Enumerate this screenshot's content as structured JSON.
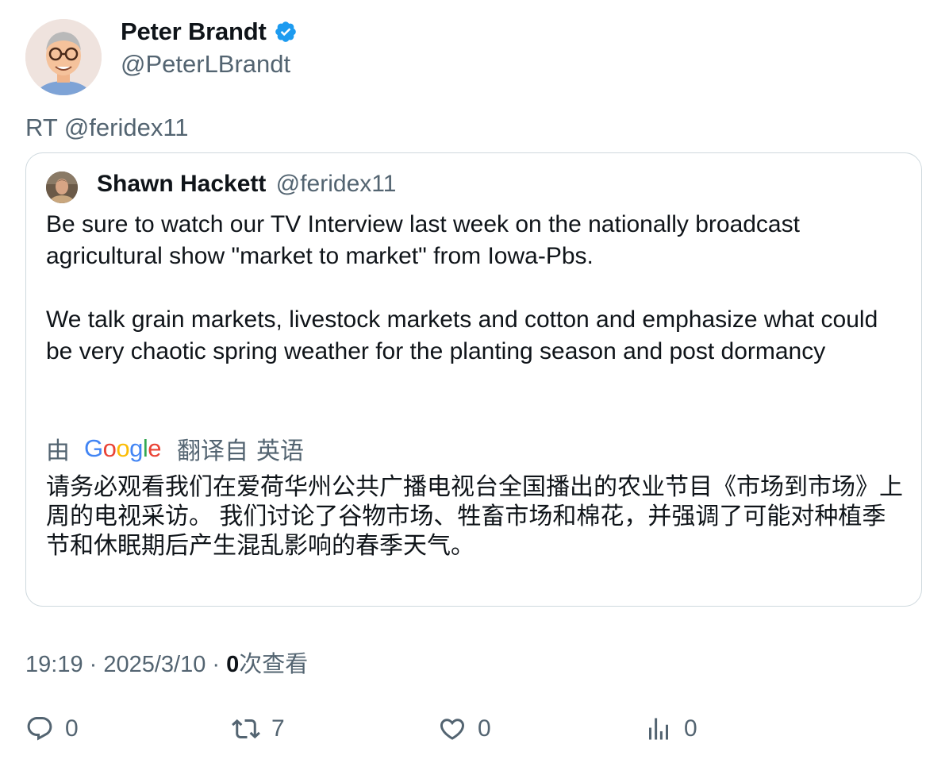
{
  "author": {
    "display_name": "Peter Brandt",
    "handle": "@PeterLBrandt",
    "verified_color": "#1d9bf0"
  },
  "retweet_line": "RT @feridex11",
  "quoted": {
    "display_name": "Shawn Hackett",
    "handle": "@feridex11",
    "paragraphs": [
      "Be sure to watch our TV Interview last week on the nationally broadcast agricultural show \"market to market\" from Iowa-Pbs.",
      "We talk grain markets, livestock markets and cotton and emphasize what could be very chaotic spring weather for the planting season and post dormancy"
    ],
    "translation": {
      "by_label": "由",
      "provider": "Google",
      "from_label": "翻译自",
      "language": "英语",
      "text": "请务必观看我们在爱荷华州公共广播电视台全国播出的农业节目《市场到市场》上周的电视采访。 我们讨论了谷物市场、牲畜市场和棉花，并强调了可能对种植季节和休眠期后产生混乱影响的春季天气。"
    }
  },
  "meta": {
    "time": "19:19",
    "separator": " · ",
    "date": "2025/3/10",
    "views_count": "0",
    "views_label": "次查看"
  },
  "actions": {
    "replies": "0",
    "retweets": "7",
    "likes": "0",
    "views": "0"
  },
  "icons": {
    "avatar": "user-avatar-icon",
    "verified": "verified-badge-icon",
    "reply": "reply-icon",
    "retweet": "retweet-icon",
    "like": "heart-icon",
    "views": "views-bar-chart-icon"
  }
}
